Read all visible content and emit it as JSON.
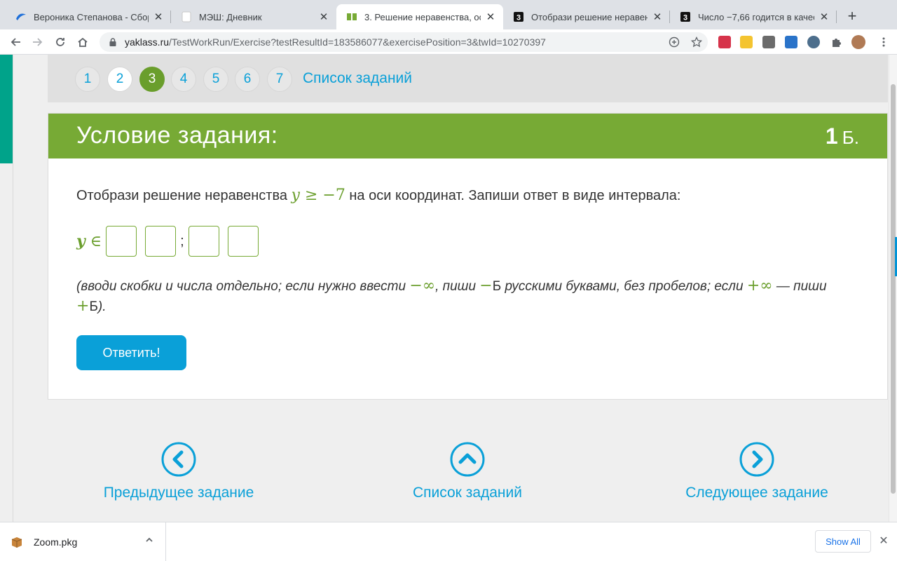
{
  "browser": {
    "tabs": [
      {
        "title": "Вероника Степанова - Сборни",
        "icon": "blue-swoosh-icon"
      },
      {
        "title": "МЭШ: Дневник",
        "icon": "blank-page-icon"
      },
      {
        "title": "3. Решение неравенства, оси",
        "icon": "yaklass-book-icon"
      },
      {
        "title": "Отобрази решение неравенс",
        "icon": "black-3-icon"
      },
      {
        "title": "Число −7,66 годится в качест",
        "icon": "black-3-icon"
      }
    ],
    "new_tab": "+",
    "url_host": "yaklass.ru",
    "url_path": "/TestWorkRun/Exercise?testResultId=183586077&exercisePosition=3&twId=10270397"
  },
  "qnav": {
    "numbers": [
      "1",
      "2",
      "3",
      "4",
      "5",
      "6",
      "7"
    ],
    "current": "3",
    "list_label": "Список заданий"
  },
  "task": {
    "header": "Условие задания:",
    "points": "1",
    "points_unit": "Б.",
    "text_before": "Отобрази решение неравенства ",
    "ineq_var": "y",
    "ineq_rel": " ≥ −7",
    "text_after": " на оси координат. Запиши ответ в виде интервала:",
    "answer_var": "y",
    "answer_in": " ∈",
    "separator": ";",
    "hint_1": "(вводи скобки и числа отдельно; если нужно ввести ",
    "hint_neg_inf": "−∞",
    "hint_2": ", пиши ",
    "hint_neg_sym": " −",
    "hint_3": "Б",
    "hint_4": " русскими буквами, без пробелов; если ",
    "hint_pos_inf": "+∞",
    "hint_5": " — пиши ",
    "hint_pos_sym": " +",
    "hint_6": "Б",
    "hint_7": ").",
    "submit": "Ответить!"
  },
  "bottom_nav": {
    "prev": "Предыдущее задание",
    "list": "Список заданий",
    "next": "Следующее задание"
  },
  "downloads": {
    "file": "Zoom.pkg",
    "show_all": "Show All"
  },
  "colors": {
    "green": "#77aa35",
    "blue": "#0aa0d8",
    "teal": "#00a38a"
  }
}
